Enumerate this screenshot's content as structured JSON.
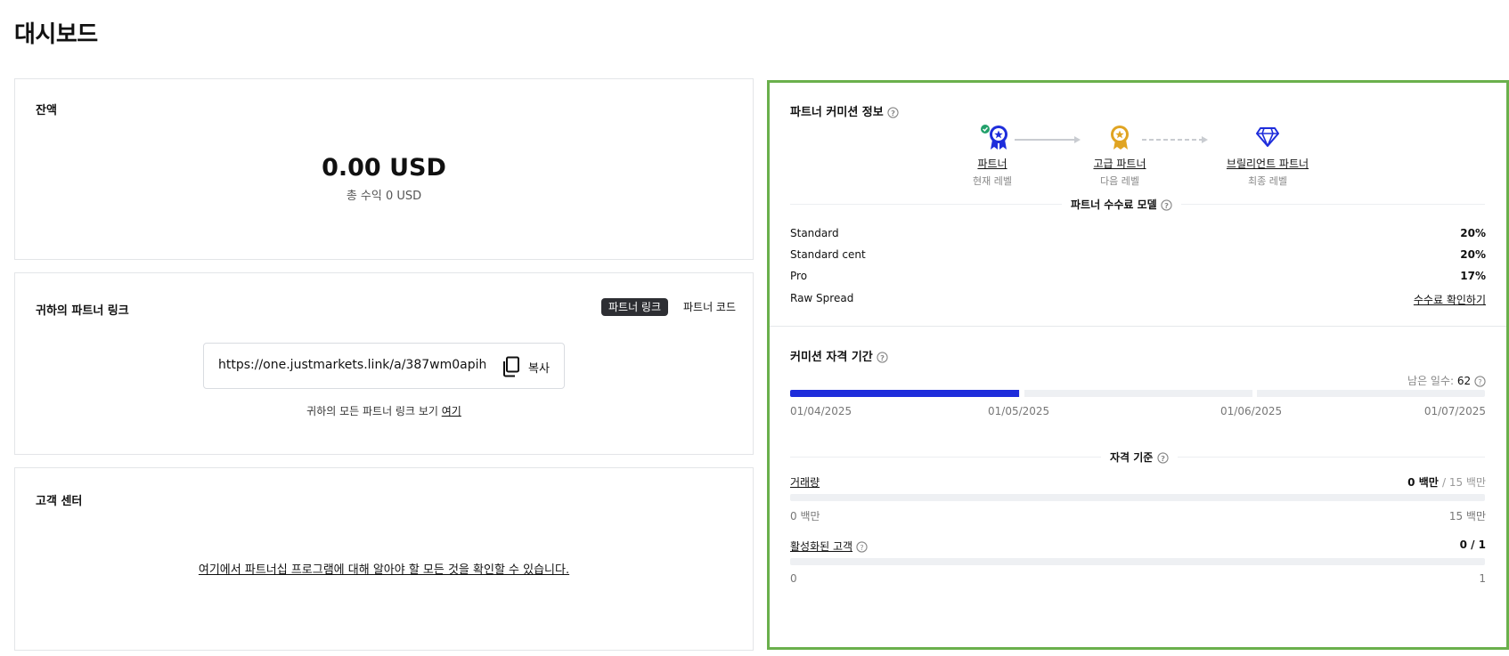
{
  "page": {
    "title": "대시보드"
  },
  "balance": {
    "title": "잔액",
    "amount": "0.00 USD",
    "total_label": "총 수익 0 USD"
  },
  "partner_link": {
    "title": "귀하의 파트너 링크",
    "tabs": [
      {
        "label": "파트너 링크",
        "active": true
      },
      {
        "label": "파트너 코드",
        "active": false
      }
    ],
    "url": "https://one.justmarkets.link/a/387wm0apih",
    "copy_label": "복사",
    "note_prefix": "귀하의 모든 파트너 링크 보기",
    "note_link": "여기"
  },
  "client_center": {
    "title": "고객 센터",
    "link": "여기에서 파트너십 프로그램에 대해 알아야 할 모든 것을 확인할 수 있습니다."
  },
  "commission": {
    "title": "파트너 커미션 정보",
    "levels": [
      {
        "name": "파트너",
        "sub": "현재 레벨",
        "icon": "ribbon-medal-icon",
        "color": "#1e2ddb",
        "achieved": true
      },
      {
        "name": "고급 파트너",
        "sub": "다음 레벨",
        "icon": "gold-medal-icon",
        "color": "#e0a422",
        "achieved": false
      },
      {
        "name": "브릴리언트 파트너",
        "sub": "최종 레벨",
        "icon": "diamond-icon",
        "color": "#1e2ddb",
        "achieved": false
      }
    ],
    "model_title": "파트너 수수료 모델",
    "rows": [
      {
        "label": "Standard",
        "value": "20%"
      },
      {
        "label": "Standard cent",
        "value": "20%"
      },
      {
        "label": "Pro",
        "value": "17%"
      },
      {
        "label": "Raw Spread",
        "value": "수수료 확인하기",
        "link": true
      }
    ]
  },
  "qualification": {
    "title": "커미션 자격 기간",
    "days_left_label": "남은 일수:",
    "days_left": "62",
    "progress": 0.33,
    "dates": [
      "01/04/2025",
      "01/05/2025",
      "01/06/2025",
      "01/07/2025"
    ],
    "criteria_title": "자격 기준",
    "volume": {
      "label": "거래량",
      "current": "0 백만",
      "target": "/ 15 백만",
      "min": "0 백만",
      "max": "15 백만",
      "progress": 0
    },
    "clients": {
      "label": "활성화된 고객",
      "value": "0 / 1",
      "min": "0",
      "max": "1",
      "progress": 0
    }
  },
  "colors": {
    "accent": "#1e2ddb",
    "gold": "#e0a422",
    "success": "#22a06b",
    "highlight_border": "#6ab04c"
  }
}
